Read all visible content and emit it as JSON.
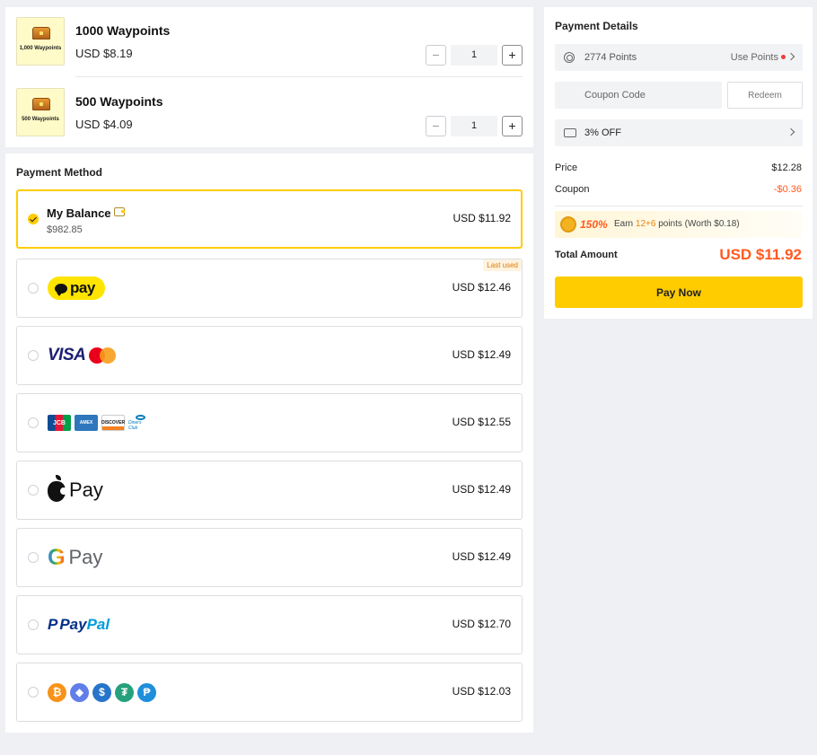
{
  "cart": {
    "items": [
      {
        "thumb_label": "1,000 Waypoints",
        "name": "1000 Waypoints",
        "price": "USD $8.19",
        "quantity": "1",
        "minus_label": "−",
        "plus_label": "+"
      },
      {
        "thumb_label": "500 Waypoints",
        "name": "500 Waypoints",
        "price": "USD $4.09",
        "quantity": "1",
        "minus_label": "−",
        "plus_label": "+"
      }
    ]
  },
  "payment_method": {
    "title": "Payment Method",
    "balance": {
      "label": "My Balance",
      "amount": "$982.85",
      "price": "USD $11.92",
      "selected": true,
      "icon": "wallet-icon"
    },
    "methods": [
      {
        "name": "KakaoPay",
        "logo_text": "pay",
        "price": "USD $12.46",
        "badge": "Last used"
      },
      {
        "name": "Visa / Mastercard",
        "logo_text": "VISA",
        "mc_text": "MasterCard",
        "price": "USD $12.49"
      },
      {
        "name": "JCB / Amex / Discover / Diners",
        "jcb": "JCB",
        "amex": "AMEX",
        "discover": "DISCOVER",
        "diners": "Diners Club",
        "price": "USD $12.55"
      },
      {
        "name": "Apple Pay",
        "logo_text": "Pay",
        "price": "USD $12.49"
      },
      {
        "name": "Google Pay",
        "g_text": "G",
        "logo_text": "Pay",
        "price": "USD $12.49"
      },
      {
        "name": "PayPal",
        "pay_text": "Pay",
        "pal_text": "Pal",
        "icon_text": "P",
        "price": "USD $12.70"
      },
      {
        "name": "Crypto",
        "coins": [
          "₿",
          "◆",
          "$",
          "₮",
          "₱"
        ],
        "colors": [
          "#f7931a",
          "#627eea",
          "#2775ca",
          "#26a17b",
          "#1f8fdb"
        ],
        "price": "USD $12.03"
      }
    ]
  },
  "details": {
    "title": "Payment Details",
    "points": {
      "value": "2774 Points",
      "action": "Use Points"
    },
    "coupon": {
      "placeholder": "Coupon Code",
      "button": "Redeem"
    },
    "discount": "3% OFF",
    "price_label": "Price",
    "price_value": "$12.28",
    "coupon_label": "Coupon",
    "coupon_value": "-$0.36",
    "earn": {
      "percent": "150%",
      "text_prefix": "Earn ",
      "points": "12+6",
      "text_suffix": " points (Worth $0.18)"
    },
    "total_label": "Total Amount",
    "total_value": "USD $11.92",
    "pay_button": "Pay Now"
  },
  "colors": {
    "accent": "#ffcc00",
    "price_highlight": "#ff5a1f"
  }
}
